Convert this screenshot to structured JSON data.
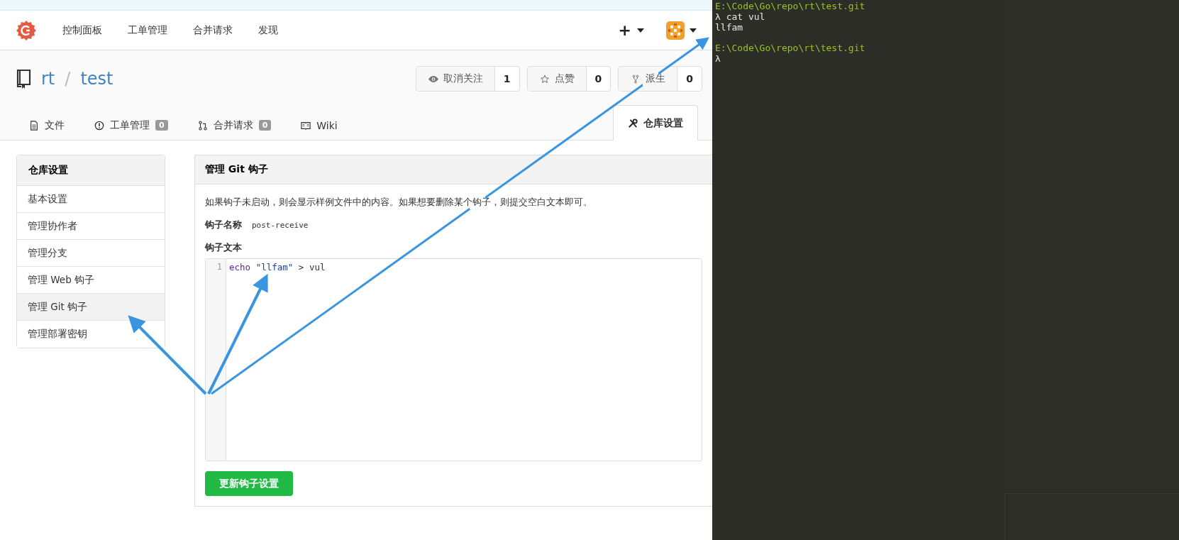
{
  "nav": {
    "items": [
      "控制面板",
      "工单管理",
      "合并请求",
      "发现"
    ],
    "create": "+"
  },
  "repo": {
    "owner": "rt",
    "separator": "/",
    "name": "test",
    "actions": [
      {
        "kind": "watch",
        "label": "取消关注",
        "count": "1"
      },
      {
        "kind": "star",
        "label": "点赞",
        "count": "0"
      },
      {
        "kind": "fork",
        "label": "派生",
        "count": "0"
      }
    ]
  },
  "tabs": [
    {
      "kind": "file",
      "label": "文件",
      "selected": false
    },
    {
      "kind": "issue",
      "label": "工单管理",
      "badge": "0",
      "selected": false
    },
    {
      "kind": "pr",
      "label": "合并请求",
      "badge": "0",
      "selected": false
    },
    {
      "kind": "wiki",
      "label": "Wiki",
      "selected": false
    },
    {
      "kind": "settings",
      "label": "仓库设置",
      "selected": true
    }
  ],
  "sidebar": {
    "title": "仓库设置",
    "items": [
      {
        "label": "基本设置",
        "selected": false
      },
      {
        "label": "管理协作者",
        "selected": false
      },
      {
        "label": "管理分支",
        "selected": false
      },
      {
        "label": "管理 Web 钩子",
        "selected": false
      },
      {
        "label": "管理 Git 钩子",
        "selected": true
      },
      {
        "label": "管理部署密钥",
        "selected": false
      }
    ]
  },
  "panel": {
    "title": "管理 Git 钩子",
    "description": "如果钩子未启动，则会显示样例文件中的内容。如果想要删除某个钩子，则提交空白文本即可。",
    "name_label": "钩子名称",
    "name_value": "post-receive",
    "content_label": "钩子文本",
    "editor": {
      "lines": [
        {
          "number": "1",
          "tokens": [
            {
              "kind": "keyword",
              "text": "echo "
            },
            {
              "kind": "string",
              "text": "\"llfam\""
            },
            {
              "kind": "plain",
              "text": " > vul"
            }
          ]
        }
      ]
    },
    "button": "更新钩子设置"
  },
  "terminal": {
    "blocks": [
      {
        "path": "E:\\Code\\Go\\repo\\rt\\test.git",
        "lines": [
          "λ cat vul",
          "llfam"
        ]
      },
      {
        "path": "E:\\Code\\Go\\repo\\rt\\test.git",
        "lines": [
          "λ"
        ]
      }
    ]
  }
}
